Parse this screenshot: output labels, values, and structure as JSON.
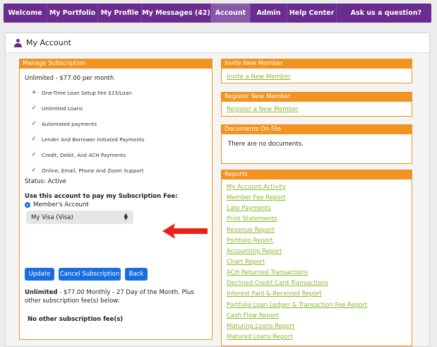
{
  "nav": {
    "items": [
      "Welcome",
      "My Portfolio",
      "My Profile",
      "My Messages (42)",
      "Account",
      "Admin",
      "Help Center"
    ],
    "ask": "Ask us a question?",
    "active": "Account"
  },
  "page": {
    "title": "My Account"
  },
  "subscription": {
    "header": "Manage Subscription",
    "plan": "Unlimited - $77.00 per month",
    "features": [
      {
        "icon": "plus-icon",
        "text": "One-Time Loan Setup Fee $23/Loan"
      },
      {
        "icon": "check-icon",
        "text": "Unlimited Loans"
      },
      {
        "icon": "check-icon",
        "text": "Automated payments"
      },
      {
        "icon": "check-icon",
        "text": "Lender And Borrower Initiated Payments"
      },
      {
        "icon": "check-icon",
        "text": "Credit, Debit, And ACH Payments"
      },
      {
        "icon": "check-icon",
        "text": "Online, Email, Phone And Zoom Support"
      }
    ],
    "status": "Status: Active",
    "pay_fee_label": "Use this account to pay my Subscription Fee:",
    "radio_label": "Member's Account",
    "select_value": "My Visa (Visa)",
    "buttons": {
      "update": "Update",
      "cancel": "Cancel Subscription",
      "back": "Back"
    },
    "note_bold": "Unlimited",
    "note_rest": " - $77.00 Monthly - 27 Day of the Month. Plus other subscription fee(s) below:",
    "no_other": "No other subscription fee(s)"
  },
  "invite": {
    "header": "Invite New Member",
    "link": "Invite a New Member"
  },
  "register": {
    "header": "Register New Member",
    "link": "Register a New Member"
  },
  "documents": {
    "header": "Documents On File",
    "empty": "There are no documents."
  },
  "reports": {
    "header": "Reports",
    "links": [
      "My Account Activity",
      "Member Fee Report",
      "Late Payments",
      "Print Statements",
      "Revenue Report",
      "Portfolio Report",
      "Accounting Report",
      "Chart Report",
      "ACH Returned Transactions",
      "Declined Credit Card Transactions",
      "Interest Paid & Received Report",
      "Portfolio Loan Ledger & Transaction Fee Report",
      "Cash Flow Report",
      "Maturing Loans Report",
      "Matured Loans Report"
    ]
  },
  "colors": {
    "nav": "#6a2c8f",
    "accent": "#f2921f",
    "link": "#8ab82c",
    "button": "#1a6fe0",
    "arrow": "#e8221b"
  }
}
